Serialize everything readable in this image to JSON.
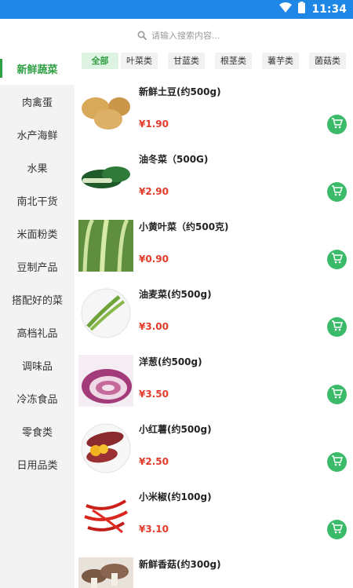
{
  "status_bar": {
    "time": "11:34"
  },
  "search": {
    "placeholder": "请输入搜索内容..."
  },
  "sidebar": {
    "items": [
      {
        "label": "新鲜蔬菜"
      },
      {
        "label": "肉禽蛋"
      },
      {
        "label": "水产海鲜"
      },
      {
        "label": "水果"
      },
      {
        "label": "南北干货"
      },
      {
        "label": "米面粉类"
      },
      {
        "label": "豆制产品"
      },
      {
        "label": "搭配好的菜"
      },
      {
        "label": "高档礼品"
      },
      {
        "label": "调味品"
      },
      {
        "label": "冷冻食品"
      },
      {
        "label": "零食类"
      },
      {
        "label": "日用品类"
      }
    ]
  },
  "filters": [
    {
      "label": "全部"
    },
    {
      "label": "叶菜类"
    },
    {
      "label": "甘蓝类"
    },
    {
      "label": "根茎类"
    },
    {
      "label": "薯芋类"
    },
    {
      "label": "菌菇类"
    }
  ],
  "products": [
    {
      "name": "新鲜土豆(约500g)",
      "price": "¥1.90",
      "image": "potato"
    },
    {
      "name": "油冬菜（500G)",
      "price": "¥2.90",
      "image": "bok-choy"
    },
    {
      "name": "小黄叶菜（约500克)",
      "price": "¥0.90",
      "image": "leafy-greens"
    },
    {
      "name": "油麦菜(约500g)",
      "price": "¥3.00",
      "image": "lettuce-stems"
    },
    {
      "name": "洋葱(约500g)",
      "price": "¥3.50",
      "image": "red-onion"
    },
    {
      "name": "小红薯(约500g)",
      "price": "¥2.50",
      "image": "sweet-potato"
    },
    {
      "name": "小米椒(约100g)",
      "price": "¥3.10",
      "image": "red-chili"
    },
    {
      "name": "新鲜香菇(约300g)",
      "price": "",
      "image": "shiitake"
    }
  ],
  "colors": {
    "status_bar": "#1e86e5",
    "accent_green": "#2ea043",
    "cart_green": "#3bbb6a",
    "price_red": "#e23b2a",
    "sidebar_bg": "#f3f3f3"
  }
}
